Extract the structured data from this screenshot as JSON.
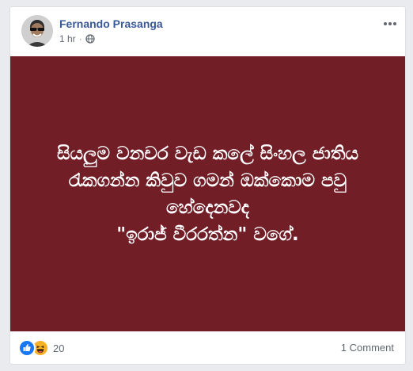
{
  "post": {
    "author": "Fernando Prasanga",
    "timestamp": "1 hr",
    "separator": "·",
    "privacy_icon": "globe-icon",
    "more_icon": "more-horizontal-icon",
    "image": {
      "background_color": "#711e27",
      "text_color": "#ffffff",
      "lines": [
        "සියලුම වනචර වැඩ කලේ සිංහල ජාතිය",
        "රැකගන්න කිවුව ගමන් ඔක්කොම පවු",
        "හේදෙනවද",
        "\"ඉරාජ් වීරරත්න\" වගේ."
      ]
    }
  },
  "footer": {
    "reaction_icons": [
      "like-reaction-icon",
      "haha-reaction-icon"
    ],
    "reaction_count": "20",
    "comments_label": "1 Comment"
  },
  "colors": {
    "author_link": "#385898",
    "meta_text": "#616770",
    "like_blue": "#1877f2",
    "haha_yellow": "#f7b125"
  }
}
